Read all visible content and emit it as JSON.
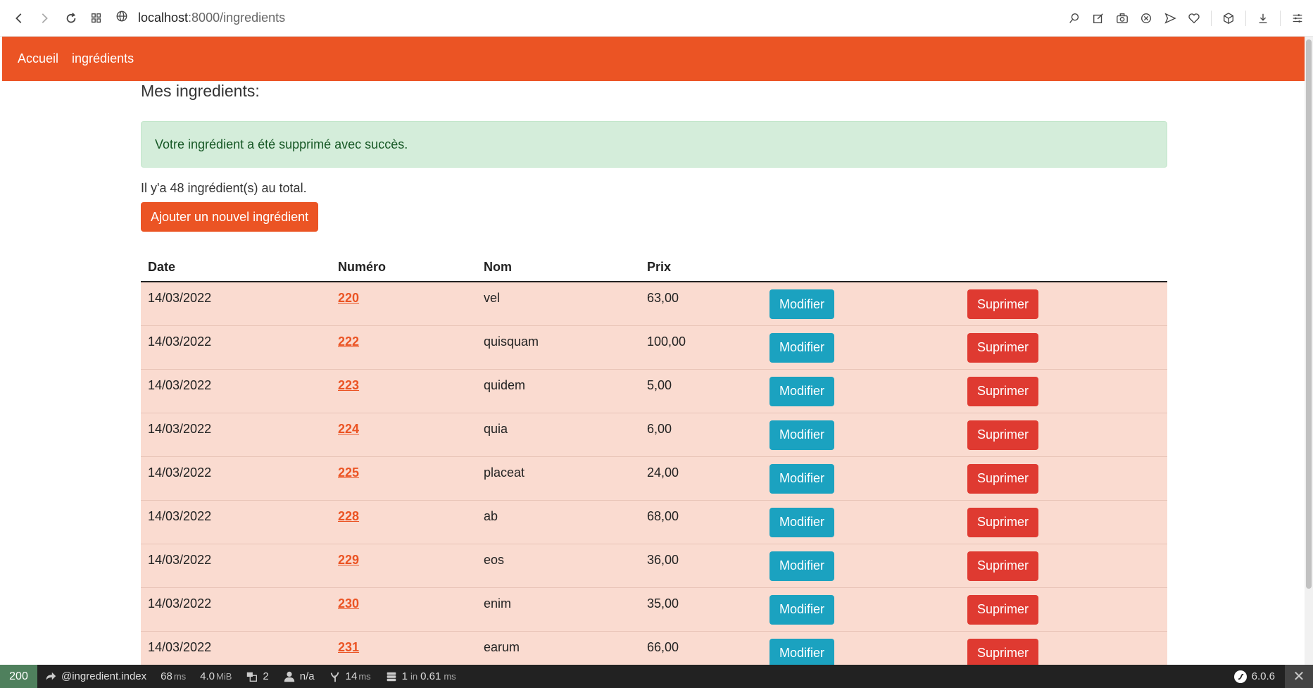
{
  "browser": {
    "url_host": "localhost",
    "url_path": ":8000/ingredients"
  },
  "nav": {
    "links": [
      "Accueil",
      "ingrédients"
    ]
  },
  "page": {
    "title": "Mes ingredients:",
    "alert": "Votre ingrédient a été supprimé avec succès.",
    "total": "Il y'a 48 ingrédient(s) au total.",
    "add_button": "Ajouter un nouvel ingrédient"
  },
  "table": {
    "headers": [
      "Date",
      "Numéro",
      "Nom",
      "Prix"
    ],
    "modifier_label": "Modifier",
    "supprimer_label": "Suprimer",
    "rows": [
      {
        "date": "14/03/2022",
        "num": "220",
        "nom": "vel",
        "prix": "63,00"
      },
      {
        "date": "14/03/2022",
        "num": "222",
        "nom": "quisquam",
        "prix": "100,00"
      },
      {
        "date": "14/03/2022",
        "num": "223",
        "nom": "quidem",
        "prix": "5,00"
      },
      {
        "date": "14/03/2022",
        "num": "224",
        "nom": "quia",
        "prix": "6,00"
      },
      {
        "date": "14/03/2022",
        "num": "225",
        "nom": "placeat",
        "prix": "24,00"
      },
      {
        "date": "14/03/2022",
        "num": "228",
        "nom": "ab",
        "prix": "68,00"
      },
      {
        "date": "14/03/2022",
        "num": "229",
        "nom": "eos",
        "prix": "36,00"
      },
      {
        "date": "14/03/2022",
        "num": "230",
        "nom": "enim",
        "prix": "35,00"
      },
      {
        "date": "14/03/2022",
        "num": "231",
        "nom": "earum",
        "prix": "66,00"
      }
    ]
  },
  "debug_toolbar": {
    "status": "200",
    "route": "@ingredient.index",
    "time_value": "68",
    "time_unit": "ms",
    "memory_value": "4.0",
    "memory_unit": "MiB",
    "forms_count": "2",
    "user": "n/a",
    "render_value": "14",
    "render_unit": "ms",
    "db_queries": "1",
    "db_in": "in",
    "db_time": "0.61",
    "db_unit": "ms",
    "version": "6.0.6"
  },
  "colors": {
    "brand": "#eb5424",
    "row_bg": "#fadbd0",
    "modifier": "#1ba2c0",
    "supprimer": "#df3a31",
    "alert_bg": "#d4edda"
  }
}
